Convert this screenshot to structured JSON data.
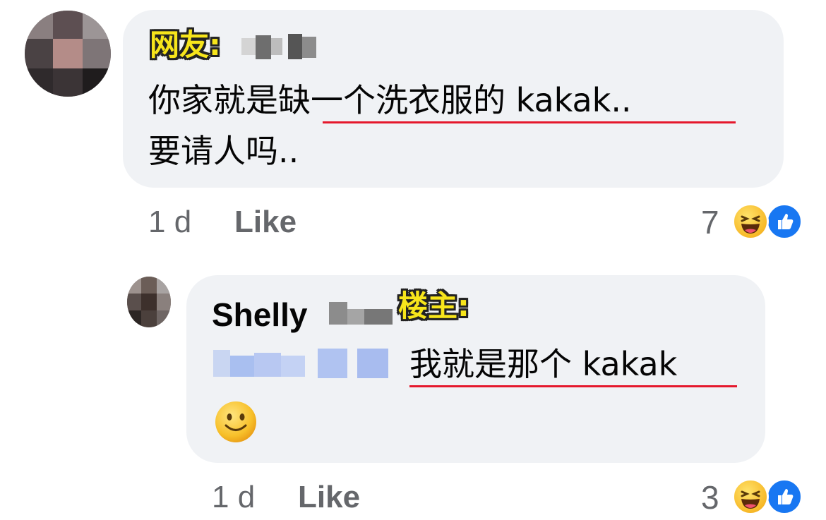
{
  "comments": [
    {
      "tag": "网友:",
      "text_line1_plain": "你家就是",
      "text_line1_underlined": "缺一个洗衣服的 kakak",
      "text_line1_tail": "..",
      "text_line2": "要请人吗..",
      "time": "1 d",
      "like_label": "Like",
      "reaction_count": "7"
    },
    {
      "author": "Shelly",
      "tag": "楼主:",
      "text_underlined": "我就是那个 kakak",
      "emoji": "🙂",
      "time": "1 d",
      "like_label": "Like",
      "reaction_count": "3"
    }
  ]
}
